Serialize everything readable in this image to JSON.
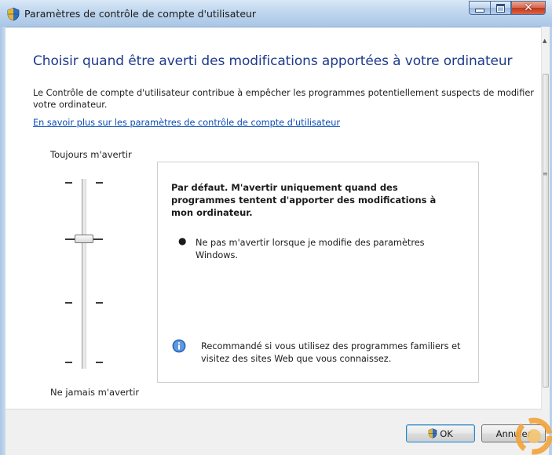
{
  "window": {
    "title": "Paramètres de contrôle de compte d'utilisateur",
    "icon": "uac-shield-icon"
  },
  "main": {
    "heading": "Choisir quand être averti des modifications apportées à votre ordinateur",
    "description": "Le Contrôle de compte d'utilisateur contribue à empêcher les programmes potentiellement suspects de modifier votre ordinateur.",
    "learn_more_link": "En savoir plus sur les paramètres de contrôle de compte d'utilisateur"
  },
  "slider": {
    "top_label": "Toujours m'avertir",
    "bottom_label": "Ne jamais m'avertir",
    "levels": 4,
    "selected_level": 2
  },
  "panel": {
    "title": "Par défaut. M'avertir uniquement quand des programmes tentent d'apporter des modifications à mon ordinateur.",
    "bullet": "Ne pas m'avertir lorsque je modifie des paramètres Windows.",
    "info_text": "Recommandé si vous utilisez des programmes familiers et visitez des sites Web que vous connaissez."
  },
  "buttons": {
    "ok": "OK",
    "cancel": "Annuler"
  },
  "colors": {
    "heading": "#1e3a8c",
    "link": "#0b4db8",
    "title_bar": "#bfd6ee",
    "close_button": "#c2361a",
    "ok_focus": "#3c7fb1"
  }
}
